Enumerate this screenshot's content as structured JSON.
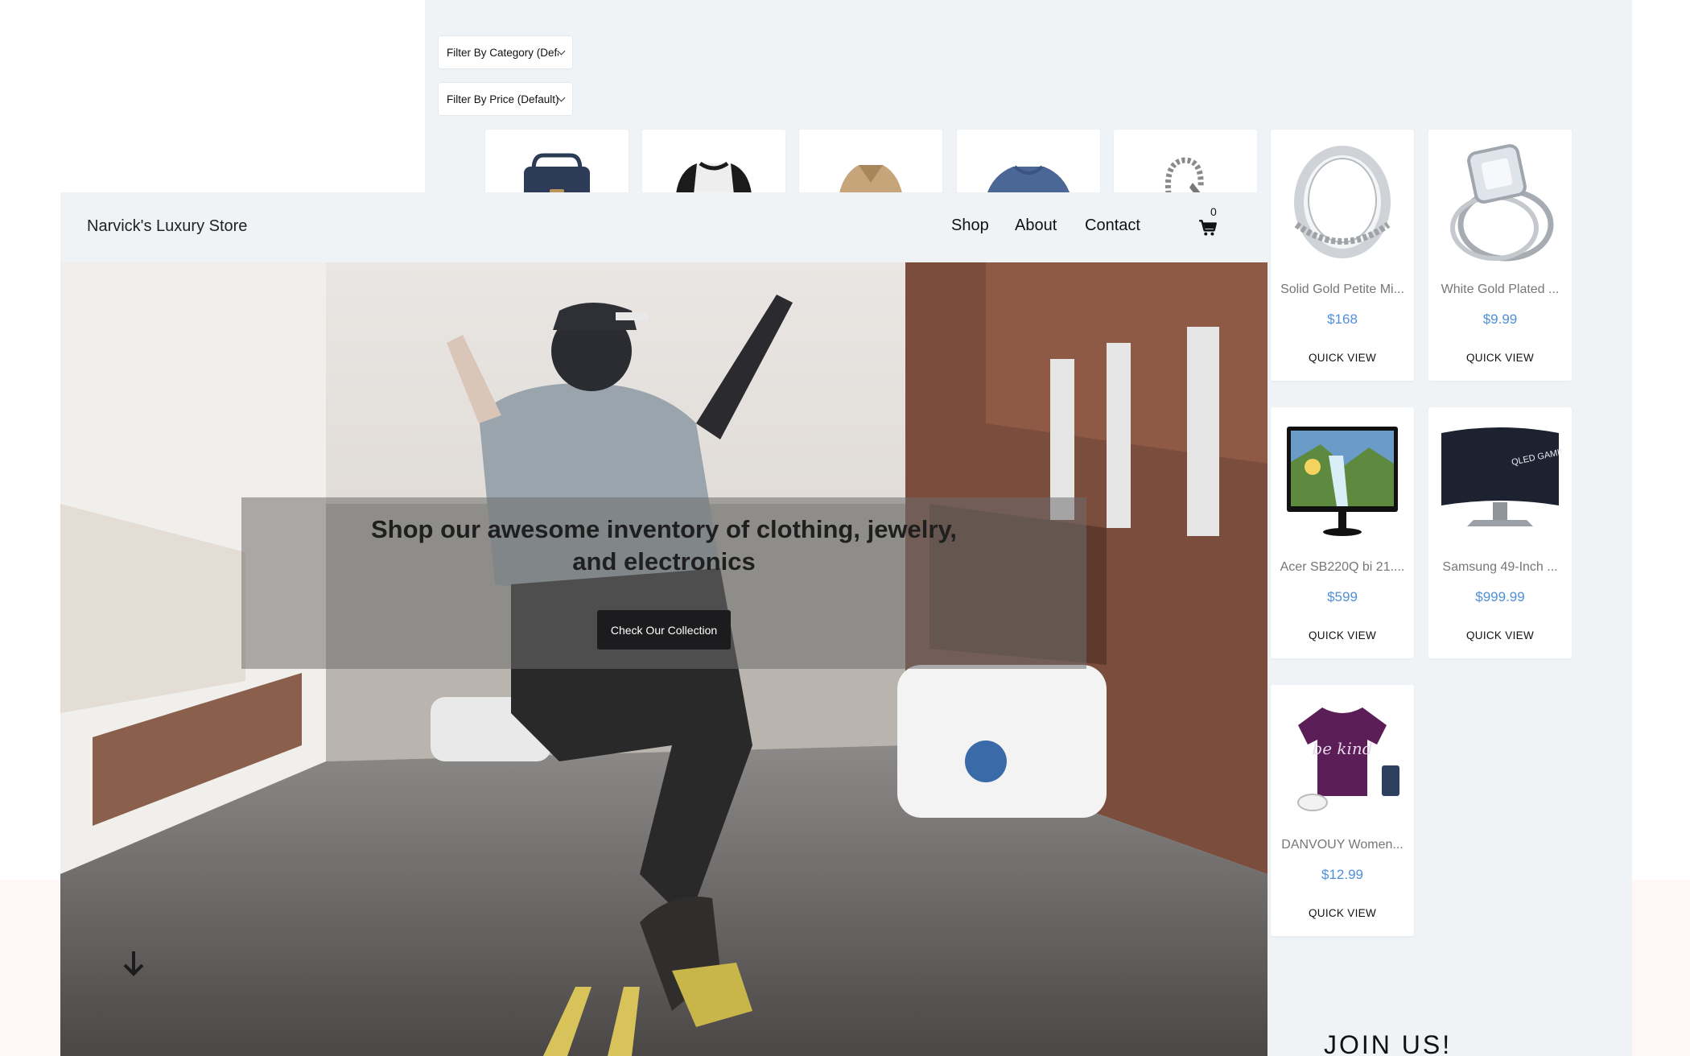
{
  "filters": {
    "category": "Filter By Category (Default)",
    "price": "Filter By Price (Default)"
  },
  "products_top_row": [
    {
      "name": "",
      "icon": "backpack-image"
    },
    {
      "name": "",
      "icon": "henley-shirt-image"
    },
    {
      "name": "",
      "icon": "jacket-image"
    },
    {
      "name": "",
      "icon": "tshirt-image"
    },
    {
      "name": "",
      "icon": "bracelet-image"
    },
    {
      "name": "Solid Gold Petite Mi...",
      "price": "$168",
      "action": "QUICK VIEW",
      "icon": "ring-image"
    },
    {
      "name": "White Gold Plated ...",
      "price": "$9.99",
      "action": "QUICK VIEW",
      "icon": "diamond-ring-image"
    }
  ],
  "products_grid": [
    {
      "name": "Acer SB220Q bi 21....",
      "price": "$599",
      "action": "QUICK VIEW",
      "icon": "monitor-image"
    },
    {
      "name": "Samsung 49-Inch ...",
      "price": "$999.99",
      "action": "QUICK VIEW",
      "icon": "curved-monitor-image",
      "screen_text": "QLED GAMING MONITOR"
    },
    {
      "name": "DANVOUY Women...",
      "price": "$12.99",
      "action": "QUICK VIEW",
      "icon": "womens-tshirt-image",
      "shirt_text": "be kind"
    }
  ],
  "nav": {
    "brand": "Narvick's Luxury Store",
    "links": [
      "Shop",
      "About",
      "Contact"
    ],
    "cart_count": "0"
  },
  "hero": {
    "headline": "Shop our awesome inventory of clothing, jewelry, and electronics",
    "cta": "Check Our Collection"
  },
  "footer": {
    "join": "JOIN US!"
  },
  "colors": {
    "shop_bg": "#eff3f6",
    "price": "#4f8fd6",
    "cta_bg": "#1c1c1e"
  }
}
